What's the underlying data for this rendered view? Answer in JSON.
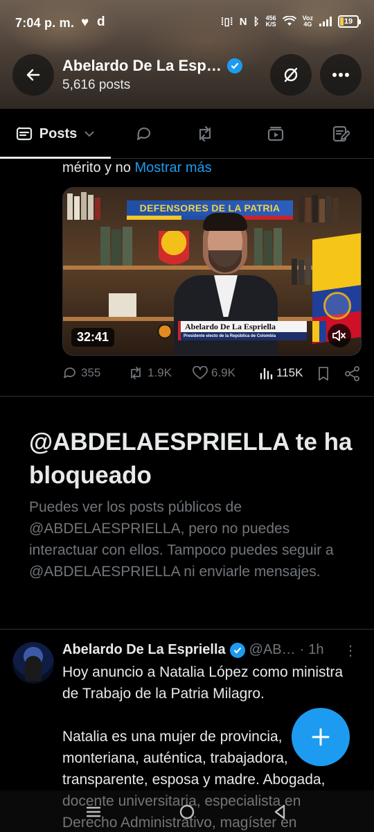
{
  "status_bar": {
    "time": "7:04 p. m.",
    "net_speed_value": "456",
    "net_speed_unit": "K/S",
    "voz": "Voz",
    "network": "4G",
    "battery_level": "19",
    "battery_color": "#f4c94b"
  },
  "header": {
    "title": "Abelardo De La Esp…",
    "posts_count": "5,616 posts"
  },
  "tabs": {
    "posts_label": "Posts"
  },
  "previous_post": {
    "text_tail": "mérito y no ",
    "show_more": "Mostrar más",
    "video": {
      "duration": "32:41",
      "banner_text": "DEFENSORES DE LA PATRIA",
      "lower_third_name": "Abelardo De La Espriella",
      "lower_third_subtitle": "Presidente electo de la República de Colombia"
    },
    "stats": {
      "replies": "355",
      "reposts": "1.9K",
      "likes": "6.9K",
      "views": "115K"
    }
  },
  "blocked_notice": {
    "title": "@ABDELAESPRIELLA te ha bloqueado",
    "body": "Puedes ver los posts públicos de @ABDELAESPRIELLA, pero no puedes interactuar con ellos. Tampoco puedes seguir a @ABDELAESPRIELLA ni enviarle mensajes."
  },
  "next_post": {
    "author_name": "Abelardo De La Espriella",
    "handle": "@AB…",
    "separator": "·",
    "time": "1h",
    "text": "Hoy anuncio a Natalia López  como ministra de Trabajo de la Patria Milagro.\n\nNatalia es una mujer de provincia, monteriana, auténtica, trabajadora, transparente, esposa y madre. Abogada, docente universitaria, especialista en Derecho Administrativo, magíster en"
  },
  "colors": {
    "accent": "#1d9bf0",
    "muted_text": "#71767b",
    "primary_text": "#e7e9ea",
    "background": "#000000"
  }
}
